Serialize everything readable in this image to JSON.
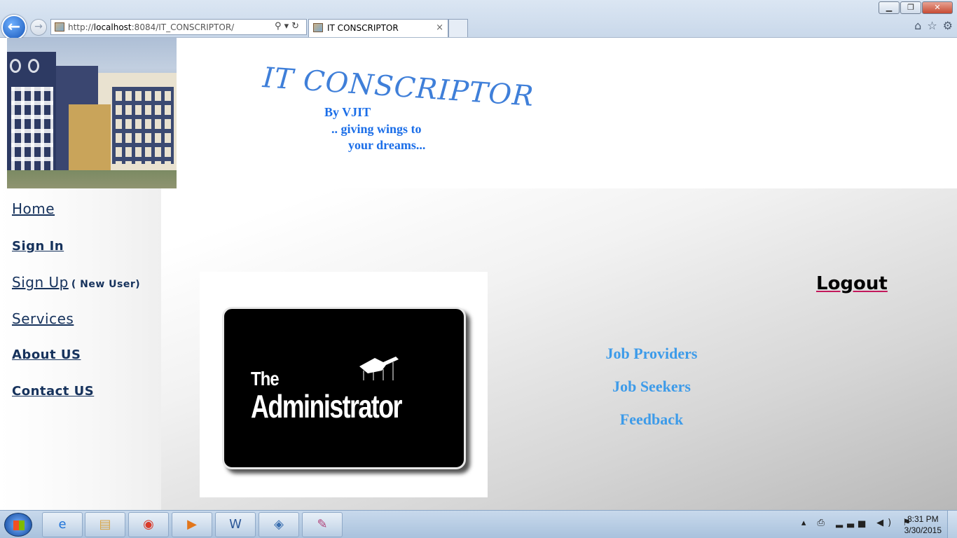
{
  "browser": {
    "url_prefix": "http://",
    "url_host": "localhost",
    "url_rest": ":8084/IT_CONSCRIPTOR/",
    "tab_title": "IT CONSCRIPTOR",
    "minimize": "▁",
    "restore": "❐",
    "close": "✕",
    "back": "←",
    "forward": "→",
    "address_controls": "⚲▾↻",
    "tab_close": "×",
    "toolbar_icons": [
      "⌂",
      "☆",
      "⚙"
    ]
  },
  "header": {
    "logo": "IT CONSCRIPTOR",
    "by_line": "By VJIT",
    "tagline_1": ".. giving wings to",
    "tagline_2": "your dreams..."
  },
  "sidebar": {
    "items": [
      {
        "label": "Home"
      },
      {
        "label": "Sign In"
      },
      {
        "label": "Sign Up",
        "note": "( New User)"
      },
      {
        "label": "Services"
      },
      {
        "label": "About US"
      },
      {
        "label": "Contact US"
      }
    ]
  },
  "main": {
    "logout": "Logout",
    "admin_image_the": "The",
    "admin_image_word": "Administrator",
    "links": [
      "Job Providers",
      "Job Seekers",
      "Feedback"
    ]
  },
  "taskbar": {
    "apps": [
      "internet-explorer-icon",
      "file-explorer-icon",
      "chrome-icon",
      "media-player-icon",
      "word-icon",
      "virtualbox-icon",
      "paint-icon"
    ],
    "tray_icons": "▴ ⎙ ▂▃▅ ◀) ⚑",
    "time": "8:31 PM",
    "date": "3/30/2015"
  }
}
